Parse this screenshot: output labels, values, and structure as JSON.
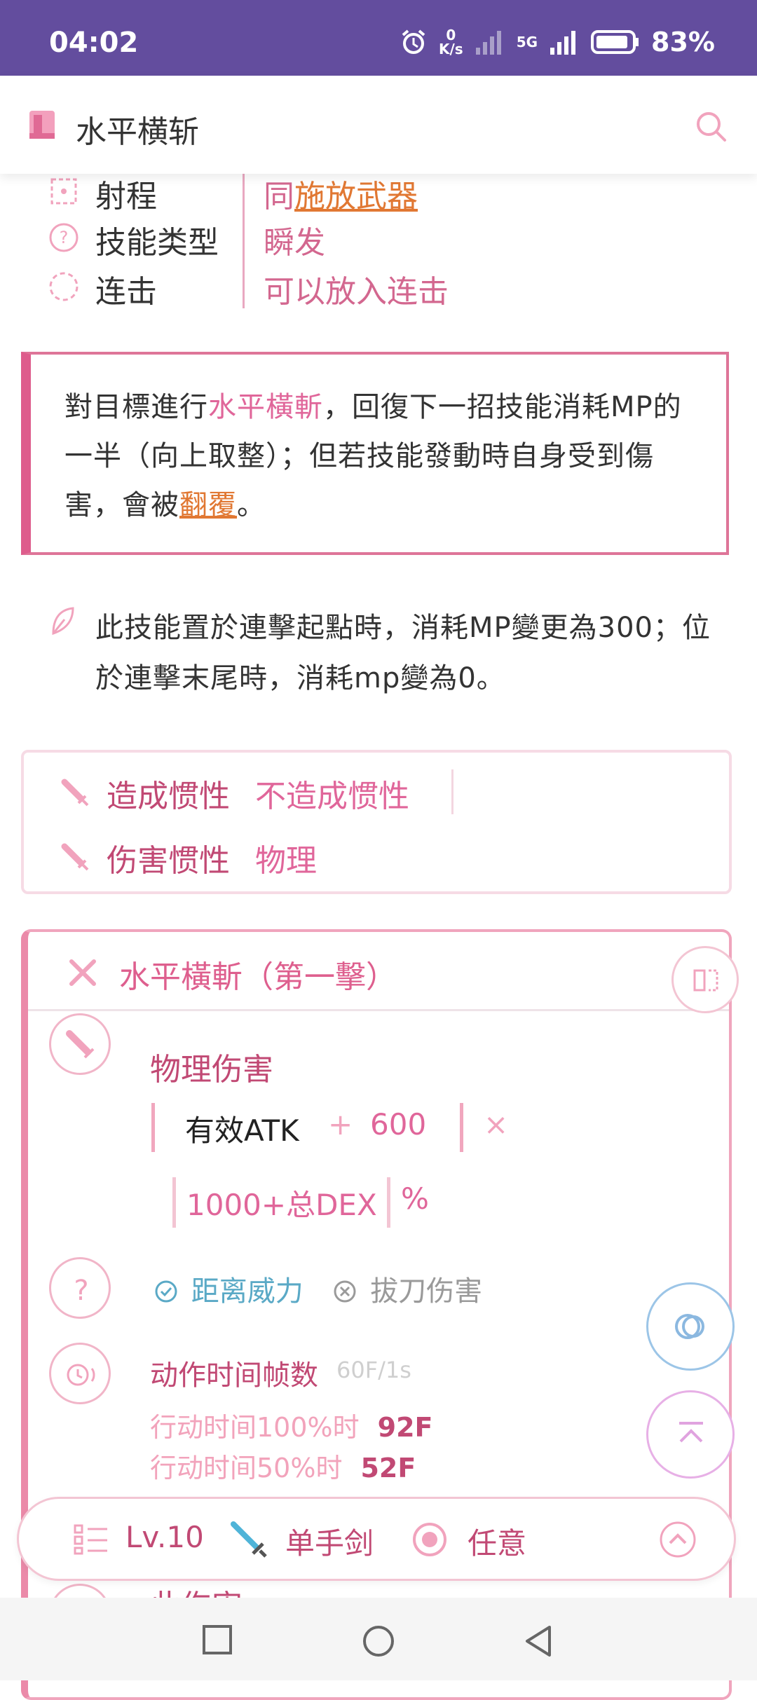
{
  "status_bar": {
    "time": "04:02",
    "net_speed_top": "0",
    "net_speed_unit": "K/s",
    "network": "5G",
    "battery": "83%"
  },
  "app_bar": {
    "title": "水平横斩"
  },
  "info_rows": [
    {
      "icon": "range-icon",
      "label": "射程",
      "value_prefix": "同",
      "value_link": "施放武器"
    },
    {
      "icon": "question-icon",
      "label": "技能类型",
      "value": "瞬发"
    },
    {
      "icon": "combo-icon",
      "label": "连击",
      "value": "可以放入连击"
    }
  ],
  "description": {
    "part1": "對目標進行",
    "highlight": "水平橫斬",
    "part2": "，回復下一招技能消耗MP的一半（向上取整）；但若技能發動時自身受到傷害，會被",
    "link": "翻覆",
    "part3": "。"
  },
  "note": {
    "text": "此技能置於連擊起點時，消耗MP變更為300；位於連擊末尾時，消耗mp變為0。"
  },
  "inertia": {
    "cause_label": "造成惯性",
    "cause_value": "不造成惯性",
    "damage_label": "伤害惯性",
    "damage_value": "物理"
  },
  "damage_card": {
    "title": "水平橫斬（第一擊）",
    "damage_type": "物理伤害",
    "formula_atk": "有效ATK",
    "formula_plus": "+",
    "formula_const": "600",
    "formula_times": "×",
    "formula_dex": "1000+总DEX",
    "formula_pct": "%",
    "distance_power": "距离威力",
    "draw_damage": "拔刀伤害",
    "action_title": "动作时间帧数",
    "action_rate": "60F/1s",
    "action_100_label": "行动时间100%时",
    "action_100_value": "92F",
    "action_50_label": "行动时间50%时",
    "action_50_value": "52F",
    "next_section_peek": "此伤害"
  },
  "bottom_bar": {
    "level": "Lv.10",
    "weapon": "单手剑",
    "target": "任意"
  },
  "colors": {
    "primary": "#634d9e",
    "accent_pink": "#de5f8e",
    "link_orange": "#e17833",
    "deep_pink": "#c14974"
  }
}
